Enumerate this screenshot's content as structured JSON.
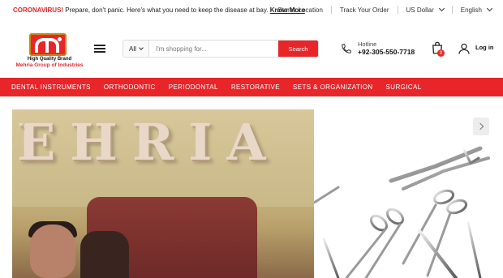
{
  "topbar": {
    "notice_highlight": "CORONAVIRUS!",
    "notice_text": " Prepare, don't panic. Here's what you need to keep the disease at bay. ",
    "notice_link": "Know More",
    "stores_location": "Stores Location",
    "track_order": "Track Your Order",
    "currency": "US Dollar",
    "language": "English"
  },
  "logo": {
    "tagline": "High Quality Brand",
    "company": "Mehria Group of Industries"
  },
  "search": {
    "category": "All",
    "placeholder": "I'm shopping for...",
    "button": "Search"
  },
  "hotline": {
    "label": "Hotline",
    "number": "+92-305-550-7718"
  },
  "cart": {
    "count": "0"
  },
  "account": {
    "login": "Log in"
  },
  "nav": {
    "items": [
      "DENTAL INSTRUMENTS",
      "ORTHODONTIC",
      "PERIODONTAL",
      "RESTORATIVE",
      "SETS & ORGANIZATION",
      "SURGICAL"
    ]
  },
  "hero": {
    "sign_text": "EHRIA"
  },
  "colors": {
    "brand_red": "#e8262a",
    "text": "#222222"
  }
}
